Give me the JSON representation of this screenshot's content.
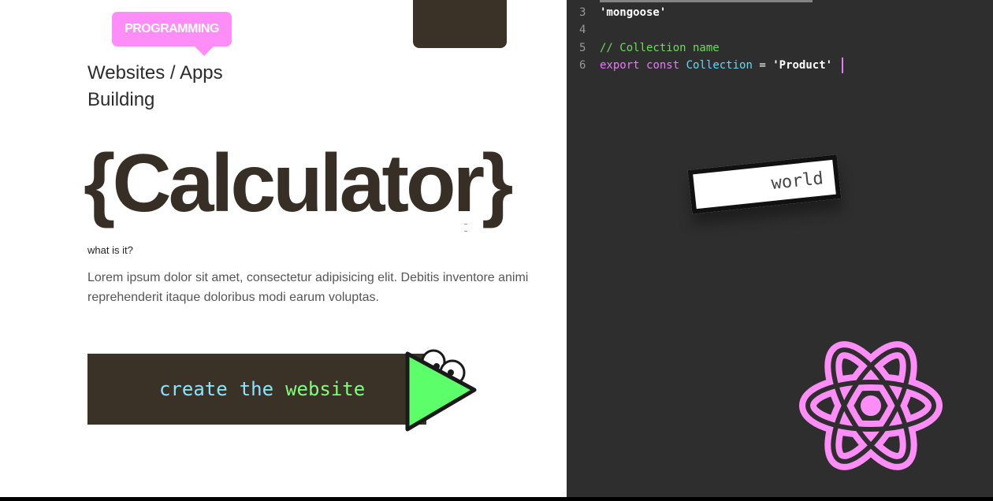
{
  "tag": {
    "label": "PROGRAMMING",
    "color": "#ff8df8"
  },
  "subtitle": {
    "line1": "Websites / Apps",
    "line2": "Building"
  },
  "hero": {
    "title": "{Calculator}"
  },
  "intro": {
    "question": "what is it?",
    "description": "Lorem ipsum dolor sit amet, consectetur adipisicing elit. Debitis inventore animi reprehenderit itaque doloribus modi earum voluptas."
  },
  "cta": {
    "word1": "create",
    "word2": "the",
    "word3": "website"
  },
  "code": {
    "lines": [
      {
        "num": "3",
        "text": "'mongoose'"
      },
      {
        "num": "4",
        "text": ""
      },
      {
        "num": "5",
        "text": "// Collection name"
      },
      {
        "num": "6",
        "kw1": "export",
        "kw2": "const",
        "ident": "Collection",
        "op": "=",
        "str": "'Product'"
      }
    ]
  },
  "card": {
    "text": "world"
  },
  "colors": {
    "left_bg": "#ffffff",
    "right_bg": "#2e2e2e",
    "dark_brown": "#3b3227",
    "pink": "#ff8df8",
    "green": "#5cff6a",
    "cyan": "#8ae4ff"
  },
  "icons": {
    "play": "play-icon",
    "react": "react-logo-icon"
  }
}
